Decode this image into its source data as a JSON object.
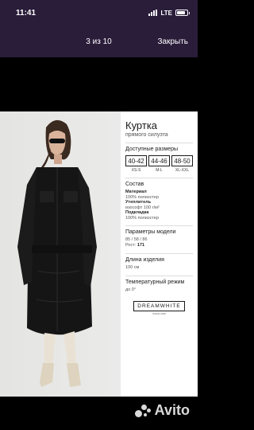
{
  "status": {
    "time": "11:41",
    "network": "LTE",
    "battery_level": 0.8
  },
  "header": {
    "counter": "3 из 10",
    "close_label": "Закрыть"
  },
  "product": {
    "title": "Куртка",
    "subtitle": "прямого силуэта",
    "sizes_heading": "Доступные размеры",
    "sizes": [
      {
        "value": "40-42",
        "label": "XS-S"
      },
      {
        "value": "44-46",
        "label": "M-L"
      },
      {
        "value": "48-50",
        "label": "XL-XXL"
      }
    ],
    "composition_heading": "Состав",
    "material_label": "Материал",
    "material_value": "100% полиэстер",
    "insulation_label": "Утеплитель",
    "insulation_value": "изософт 100 г/м²",
    "lining_label": "Подкладка",
    "lining_value": "100% полиэстер",
    "model_heading": "Параметры модели",
    "model_params": "85 / 58 / 86",
    "height_label": "Рост:",
    "height_value": "171",
    "length_heading": "Длина изделия",
    "length_value": "100 см",
    "temp_heading": "Температурный режим",
    "temp_value": "до 0°",
    "brand": "DREAMWHITE",
    "brand_sub": "SINCE 2008"
  },
  "watermark": {
    "text": "Avito"
  },
  "icons": {
    "signal": "signal-icon",
    "battery": "battery-icon",
    "avito": "avito-dots-icon"
  }
}
